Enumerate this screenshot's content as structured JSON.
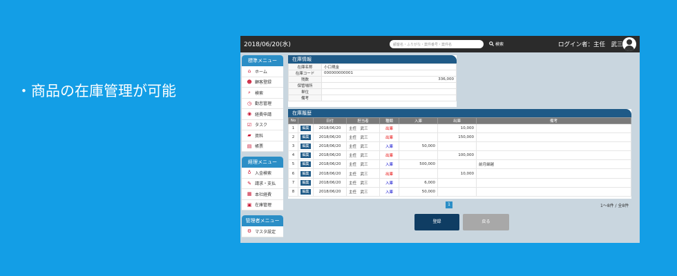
{
  "tagline": "・商品の在庫管理が可能",
  "topbar": {
    "date": "2018/06/20(水)",
    "search_placeholder": "顧客名・ふりがな・案件番号・案件名",
    "search_label": "検索",
    "login": "ログイン者：主任　武三"
  },
  "sidebar": {
    "standard": {
      "title": "標準メニュー",
      "items": [
        {
          "label": "ホーム",
          "icon": "home-icon",
          "glyph": "⌂"
        },
        {
          "label": "顧客登録",
          "icon": "customers-icon",
          "glyph": "☻"
        },
        {
          "label": "検索",
          "icon": "search-icon",
          "glyph": "⌕"
        },
        {
          "label": "勤怠管理",
          "icon": "attendance-icon",
          "glyph": "◷"
        },
        {
          "label": "経費申請",
          "icon": "expense-icon",
          "glyph": "◉"
        },
        {
          "label": "タスク",
          "icon": "task-icon",
          "glyph": "☑"
        },
        {
          "label": "資料",
          "icon": "folder-icon",
          "glyph": "▰"
        },
        {
          "label": "帳票",
          "icon": "report-icon",
          "glyph": "▤"
        }
      ]
    },
    "accounting": {
      "title": "経理メニュー",
      "items": [
        {
          "label": "入金検索",
          "icon": "deposit-icon",
          "glyph": "♁"
        },
        {
          "label": "請求・支払",
          "icon": "billing-icon",
          "glyph": "✎"
        },
        {
          "label": "本社経費",
          "icon": "office-expense-icon",
          "glyph": "▦"
        },
        {
          "label": "在庫管理",
          "icon": "inventory-icon",
          "glyph": "▣"
        }
      ]
    },
    "admin": {
      "title": "管理者メニュー",
      "items": [
        {
          "label": "マスタ設定",
          "icon": "master-settings-icon",
          "glyph": "⚙"
        }
      ]
    }
  },
  "info": {
    "title": "在庫情報",
    "rows": [
      {
        "key": "在庫名称",
        "value": "小口現金"
      },
      {
        "key": "在庫コード",
        "value": "000000000001"
      },
      {
        "key": "残数",
        "value": "336,000"
      },
      {
        "key": "保管場所",
        "value": ""
      },
      {
        "key": "単位",
        "value": ""
      },
      {
        "key": "備考",
        "value": ""
      }
    ]
  },
  "history": {
    "title": "在庫履歴",
    "headers": [
      "No",
      "",
      "日付",
      "担当者",
      "種類",
      "入庫",
      "出庫",
      "備考"
    ],
    "edit_label": "編集",
    "rows": [
      {
        "no": "1",
        "date": "2018/06/20",
        "staff": "主任　武三",
        "type": "出庫",
        "in": "",
        "out": "10,000",
        "note": ""
      },
      {
        "no": "2",
        "date": "2018/06/20",
        "staff": "主任　武三",
        "type": "出庫",
        "in": "",
        "out": "150,000",
        "note": ""
      },
      {
        "no": "3",
        "date": "2018/06/20",
        "staff": "主任　武三",
        "type": "入庫",
        "in": "50,000",
        "out": "",
        "note": ""
      },
      {
        "no": "4",
        "date": "2018/06/20",
        "staff": "主任　武三",
        "type": "出庫",
        "in": "",
        "out": "100,000",
        "note": ""
      },
      {
        "no": "5",
        "date": "2018/06/20",
        "staff": "主任　武三",
        "type": "入庫",
        "in": "500,000",
        "out": "",
        "note": "前月繰越"
      },
      {
        "no": "6",
        "date": "2018/06/20",
        "staff": "主任　武三",
        "type": "出庫",
        "in": "",
        "out": "10,000",
        "note": ""
      },
      {
        "no": "7",
        "date": "2018/06/20",
        "staff": "主任　武三",
        "type": "入庫",
        "in": "6,000",
        "out": "",
        "note": ""
      },
      {
        "no": "8",
        "date": "2018/06/20",
        "staff": "主任　武三",
        "type": "入庫",
        "in": "50,000",
        "out": "",
        "note": ""
      }
    ]
  },
  "pagination": {
    "page": "1",
    "count": "1～8件 / 全8件"
  },
  "buttons": {
    "register": "登録",
    "back": "戻る"
  },
  "colors": {
    "background": "#139ee6",
    "accent": "#1f5a87",
    "out": "#e60000",
    "in": "#0000cc"
  }
}
